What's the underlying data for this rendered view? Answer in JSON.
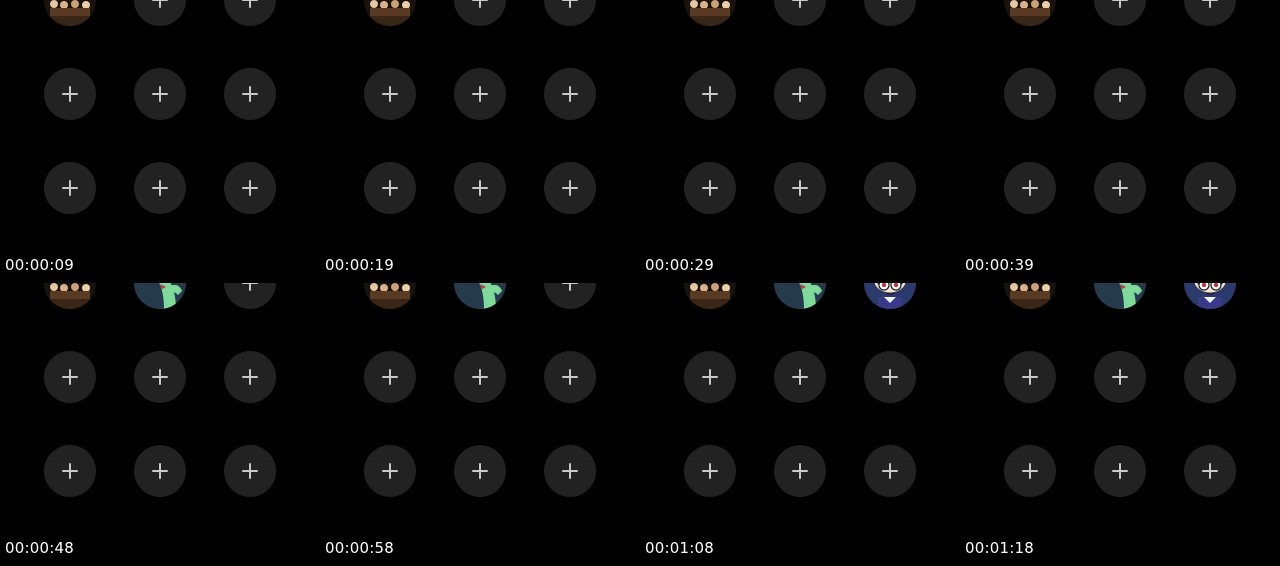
{
  "screen": {
    "description_colors": {
      "background": "#000000",
      "slot_background": "#222222",
      "plus_color": "#c8c8c8",
      "timestamp_color": "#ffffff"
    }
  },
  "frames": [
    {
      "timestamp": "00:00:09",
      "slots": [
        [
          "party-avatar",
          "add",
          "add"
        ],
        [
          "add",
          "add",
          "add"
        ],
        [
          "add",
          "add",
          "add"
        ]
      ]
    },
    {
      "timestamp": "00:00:19",
      "slots": [
        [
          "party-avatar",
          "add",
          "add"
        ],
        [
          "add",
          "add",
          "add"
        ],
        [
          "add",
          "add",
          "add"
        ]
      ]
    },
    {
      "timestamp": "00:00:29",
      "slots": [
        [
          "party-avatar",
          "add",
          "add"
        ],
        [
          "add",
          "add",
          "add"
        ],
        [
          "add",
          "add",
          "add"
        ]
      ]
    },
    {
      "timestamp": "00:00:39",
      "slots": [
        [
          "party-avatar",
          "add",
          "add"
        ],
        [
          "add",
          "add",
          "add"
        ],
        [
          "add",
          "add",
          "add"
        ]
      ]
    },
    {
      "timestamp": "00:00:48",
      "slots": [
        [
          "party-avatar",
          "frog-avatar",
          "add"
        ],
        [
          "add",
          "add",
          "add"
        ],
        [
          "add",
          "add",
          "add"
        ]
      ]
    },
    {
      "timestamp": "00:00:58",
      "slots": [
        [
          "party-avatar",
          "frog-avatar",
          "add"
        ],
        [
          "add",
          "add",
          "add"
        ],
        [
          "add",
          "add",
          "add"
        ]
      ]
    },
    {
      "timestamp": "00:01:08",
      "slots": [
        [
          "party-avatar",
          "frog-avatar",
          "anime-avatar"
        ],
        [
          "add",
          "add",
          "add"
        ],
        [
          "add",
          "add",
          "add"
        ]
      ]
    },
    {
      "timestamp": "00:01:18",
      "slots": [
        [
          "party-avatar",
          "frog-avatar",
          "anime-avatar"
        ],
        [
          "add",
          "add",
          "add"
        ],
        [
          "add",
          "add",
          "add"
        ]
      ]
    }
  ]
}
